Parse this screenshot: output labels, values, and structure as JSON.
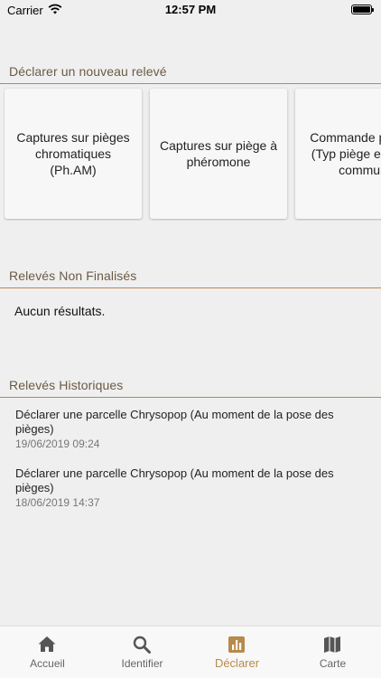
{
  "status_bar": {
    "carrier": "Carrier",
    "time": "12:57 PM"
  },
  "sections": {
    "new": "Déclarer un nouveau relevé",
    "unfinished": "Relevés Non Finalisés",
    "history": "Relevés Historiques"
  },
  "cards": [
    {
      "label": "Captures sur pièges chromatiques (Ph.AM)"
    },
    {
      "label": "Captures sur piège à phéromone"
    },
    {
      "label": "Commande pièges (Typ piège envoyé commun"
    }
  ],
  "unfinished_empty": "Aucun résultats.",
  "history": [
    {
      "title": "Déclarer une parcelle Chrysopop (Au moment de la pose des pièges)",
      "date": "19/06/2019 09:24"
    },
    {
      "title": "Déclarer une parcelle Chrysopop (Au moment de la pose des pièges)",
      "date": "18/06/2019 14:37"
    }
  ],
  "tabs": [
    {
      "label": "Accueil",
      "icon": "home-icon"
    },
    {
      "label": "Identifier",
      "icon": "search-icon"
    },
    {
      "label": "Déclarer",
      "icon": "chart-icon"
    },
    {
      "label": "Carte",
      "icon": "map-icon"
    }
  ],
  "colors": {
    "accent": "#b88a4a",
    "background": "#efefef",
    "header_text": "#6b5a44"
  }
}
